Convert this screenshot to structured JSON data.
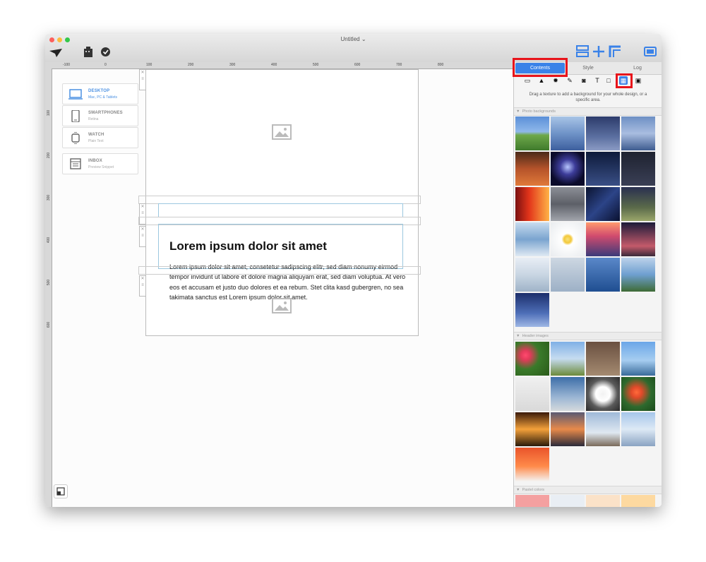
{
  "window": {
    "title": "Untitled ⌄"
  },
  "ruler": {
    "h_labels": [
      "-100",
      "0",
      "100",
      "200",
      "300",
      "400",
      "500",
      "600",
      "700",
      "800"
    ],
    "v_labels": [
      "100",
      "200",
      "300",
      "400",
      "500",
      "600"
    ]
  },
  "devices": [
    {
      "name": "DESKTOP",
      "sub": "Mac, PC & Tablets",
      "icon": "laptop-icon",
      "active": true
    },
    {
      "name": "SMARTPHONES",
      "sub": "Retina",
      "icon": "smartphone-icon",
      "active": false
    },
    {
      "name": "WATCH",
      "sub": "Plain Text",
      "icon": "watch-icon",
      "active": false
    },
    {
      "name": "INBOX",
      "sub": "Preview Snippet",
      "icon": "inbox-icon",
      "active": false
    }
  ],
  "content": {
    "heading": "Lorem ipsum dolor sit amet",
    "body": "Lorem ipsum dolor sit amet, consetetur sadipscing elitr, sed diam nonumy eirmod tempor invidunt ut labore et dolore magna aliquyam erat, sed diam voluptua. At vero eos et accusam et justo duo dolores et ea rebum. Stet clita kasd gubergren, no sea takimata sanctus est Lorem ipsum dolor sit amet."
  },
  "panel": {
    "tabs": [
      "Contents",
      "Style",
      "Log"
    ],
    "active_tab": "Contents",
    "hint": "Drag a texture to add a background for your whole design, or a specific area.",
    "sections": {
      "photo": "Photo backgrounds",
      "header": "Header images",
      "pastel": "Pastel colors"
    },
    "accent": "#3a82e8",
    "highlight": "#e8141b"
  }
}
